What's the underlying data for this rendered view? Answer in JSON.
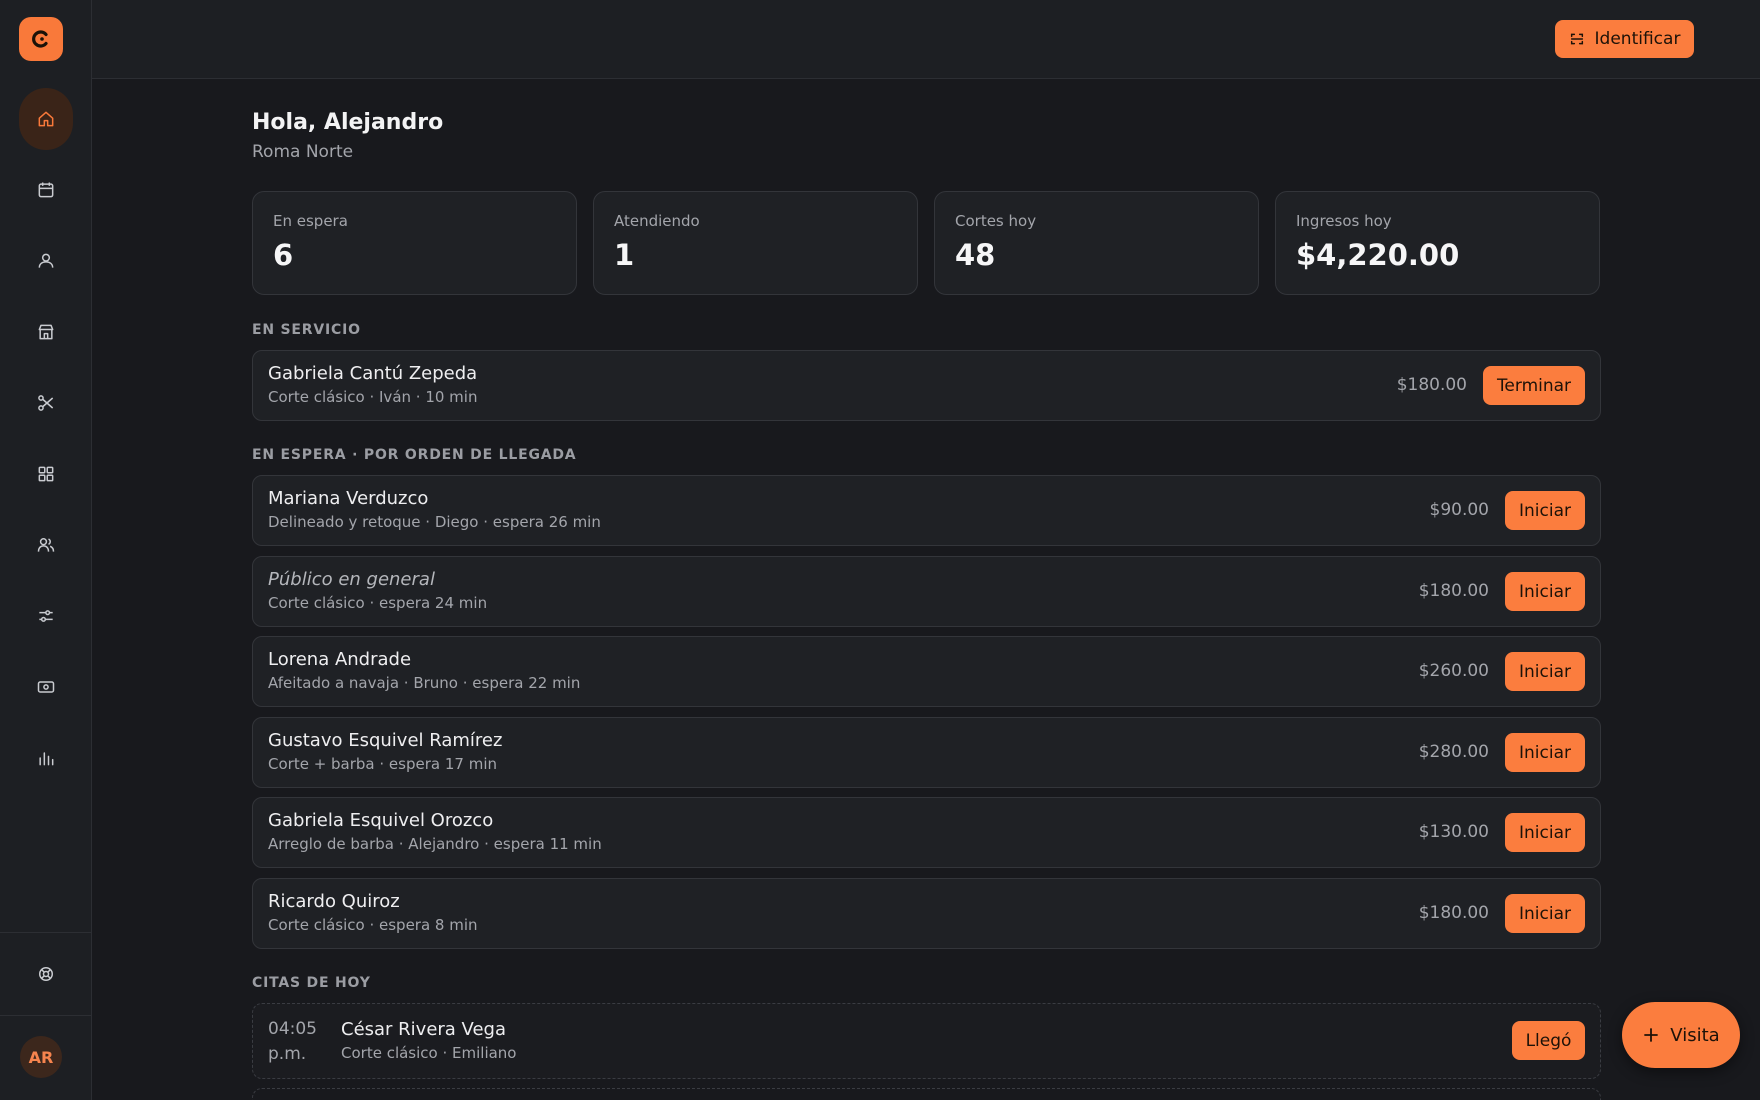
{
  "sidebar": {
    "logo_icon": "brand-logo-icon",
    "items": [
      {
        "icon": "home-icon",
        "active": true
      },
      {
        "icon": "calendar-icon"
      },
      {
        "icon": "user-icon"
      },
      {
        "icon": "store-icon"
      },
      {
        "icon": "scissors-icon"
      },
      {
        "icon": "grid-icon"
      },
      {
        "icon": "users-icon"
      },
      {
        "icon": "sliders-icon"
      },
      {
        "icon": "cash-icon"
      },
      {
        "icon": "bar-chart-icon"
      }
    ],
    "help_icon": "lifebuoy-icon",
    "avatar_initials": "AR"
  },
  "header": {
    "identify_label": "Identificar",
    "identify_icon": "scan-icon"
  },
  "greeting": "Hola, Alejandro",
  "location": "Roma Norte",
  "stats": [
    {
      "label": "En espera",
      "value": "6"
    },
    {
      "label": "Atendiendo",
      "value": "1"
    },
    {
      "label": "Cortes hoy",
      "value": "48"
    },
    {
      "label": "Ingresos hoy",
      "value": "$4,220.00"
    }
  ],
  "in_service": {
    "title": "EN SERVICIO",
    "rows": [
      {
        "name": "Gabriela Cantú Zepeda",
        "detail": "Corte clásico · Iván · 10 min",
        "price": "$180.00",
        "action": "Terminar"
      }
    ]
  },
  "waiting": {
    "title": "EN ESPERA · POR ORDEN DE LLEGADA",
    "rows": [
      {
        "name": "Mariana Verduzco",
        "detail": "Delineado y retoque · Diego · espera 26 min",
        "price": "$90.00",
        "action": "Iniciar"
      },
      {
        "name": "Público en general",
        "detail": "Corte clásico · espera 24 min",
        "price": "$180.00",
        "action": "Iniciar",
        "italic": true
      },
      {
        "name": "Lorena Andrade",
        "detail": "Afeitado a navaja · Bruno · espera 22 min",
        "price": "$260.00",
        "action": "Iniciar"
      },
      {
        "name": "Gustavo Esquivel Ramírez",
        "detail": "Corte + barba · espera 17 min",
        "price": "$280.00",
        "action": "Iniciar"
      },
      {
        "name": "Gabriela Esquivel Orozco",
        "detail": "Arreglo de barba · Alejandro · espera 11 min",
        "price": "$130.00",
        "action": "Iniciar"
      },
      {
        "name": "Ricardo Quiroz",
        "detail": "Corte clásico · espera 8 min",
        "price": "$180.00",
        "action": "Iniciar"
      }
    ]
  },
  "appointments": {
    "title": "CITAS DE HOY",
    "rows": [
      {
        "time": "04:05 p.m.",
        "name": "César Rivera Vega",
        "detail": "Corte clásico · Emiliano",
        "action": "Llegó"
      }
    ]
  },
  "fab": {
    "label": "Visita",
    "icon": "plus-icon"
  },
  "colors": {
    "accent": "#fb7d3e",
    "background": "#18191d",
    "card": "#1f2125"
  }
}
